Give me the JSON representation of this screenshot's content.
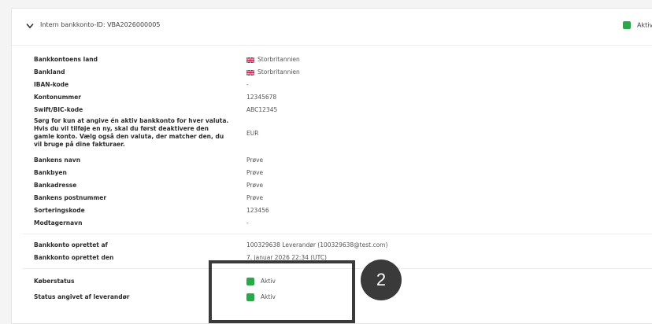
{
  "header": {
    "title": "Intern bankkonto-ID: VBA2026000005",
    "status_label": "Aktiv",
    "status_color": "#2aa84a"
  },
  "fields": [
    {
      "label": "Bankkontoens land",
      "value": "Storbritannien",
      "flag": "uk-flag-icon"
    },
    {
      "label": "Bankland",
      "value": "Storbritannien",
      "flag": "uk-flag-icon"
    },
    {
      "label": "IBAN-kode",
      "value": "-"
    },
    {
      "label": "Kontonummer",
      "value": "12345678"
    },
    {
      "label": "Swift/BIC-kode",
      "value": "ABC12345"
    },
    {
      "label": "Sørg for kun at angive én aktiv bankkonto for hver valuta. Hvis du vil tilføje en ny, skal du først deaktivere den gamle konto. Vælg også den valuta, der matcher den, du vil bruge på dine fakturaer.",
      "value": "EUR"
    },
    {
      "label": "Bankens navn",
      "value": "Prøve"
    },
    {
      "label": "Bankbyen",
      "value": "Prøve"
    },
    {
      "label": "Bankadresse",
      "value": "Prøve"
    },
    {
      "label": "Bankens postnummer",
      "value": "Prøve"
    },
    {
      "label": "Sorteringskode",
      "value": "123456"
    },
    {
      "label": "Modtagernavn",
      "value": "-"
    }
  ],
  "created": [
    {
      "label": "Bankkonto oprettet af",
      "value": "100329638 Leverandør (100329638@test.com)"
    },
    {
      "label": "Bankkonto oprettet den",
      "value": "7. januar 2026 22:34 (UTC)"
    }
  ],
  "statuses": [
    {
      "label": "Køberstatus",
      "value": "Aktiv"
    },
    {
      "label": "Status angivet af leverandør",
      "value": "Aktiv"
    }
  ],
  "overlay": {
    "step_number": "2",
    "color": "#3a3a3a"
  }
}
